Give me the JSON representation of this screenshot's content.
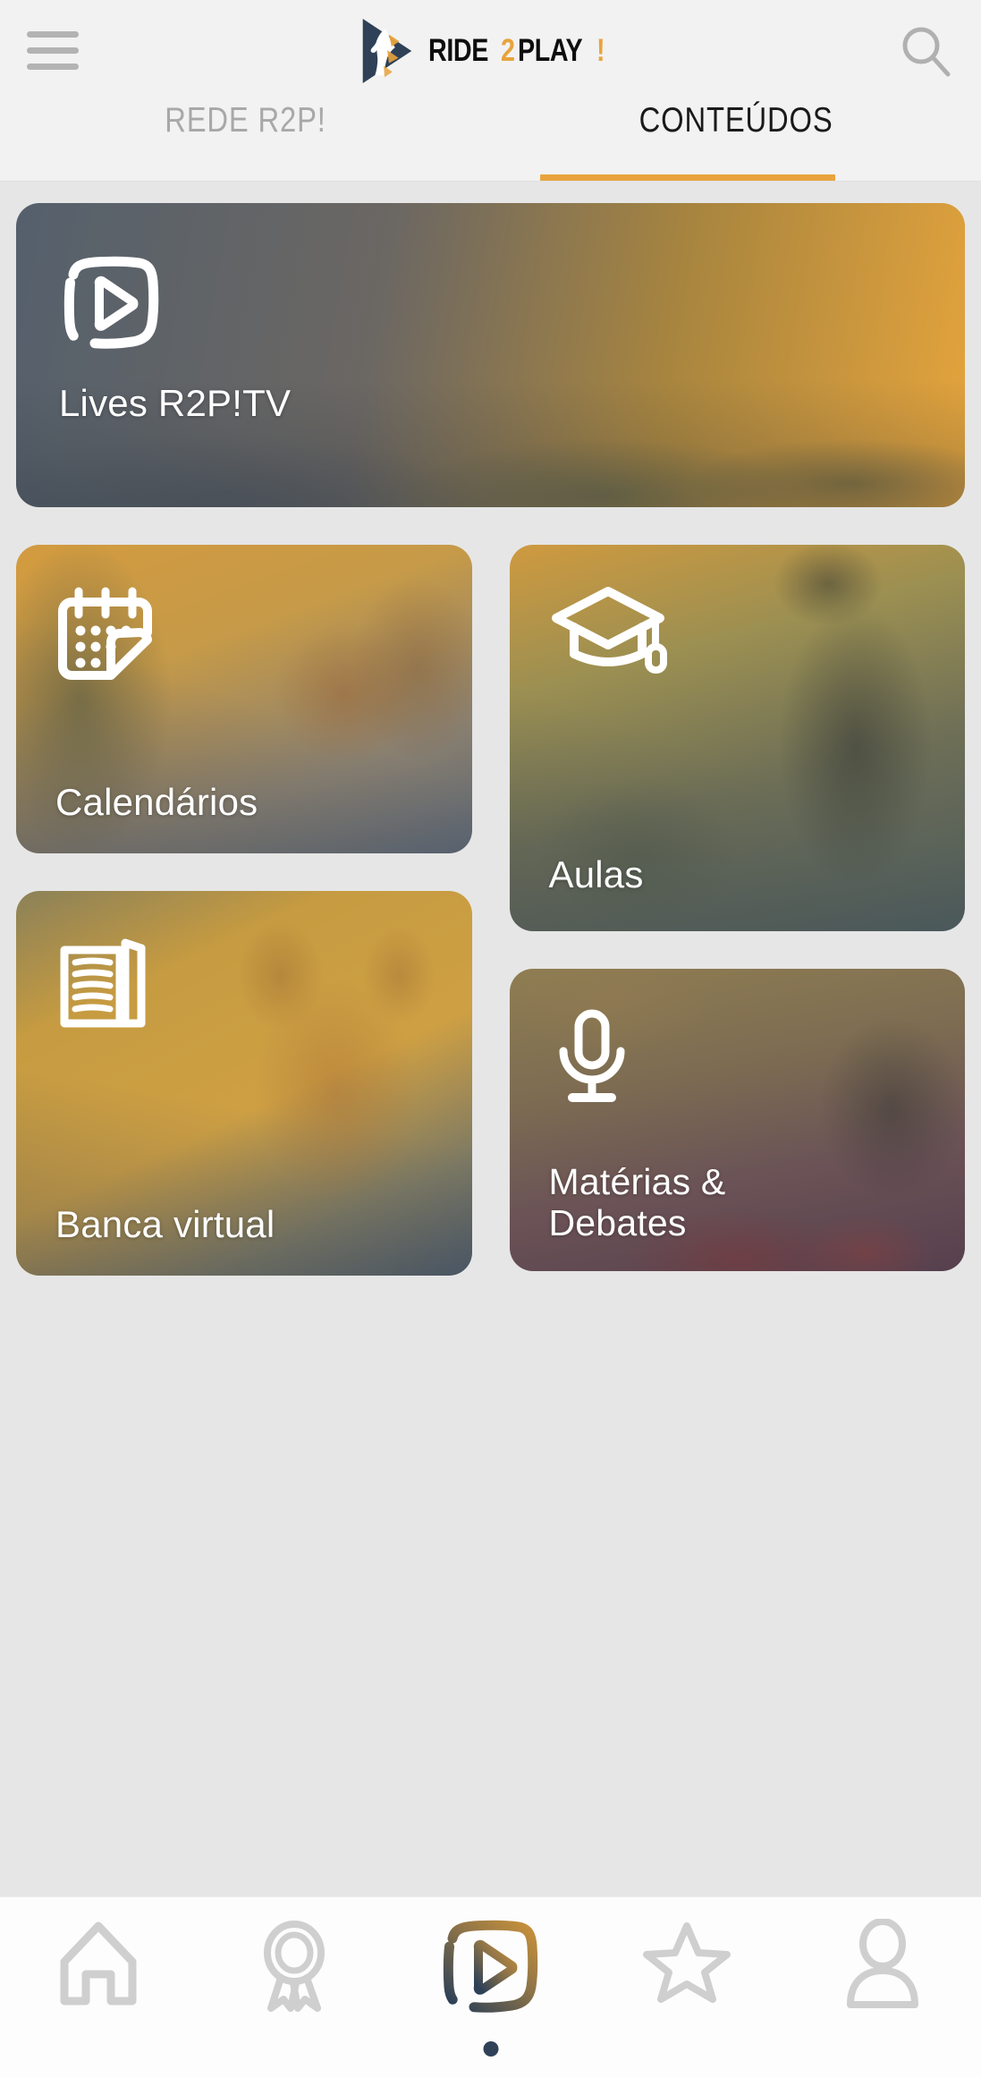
{
  "app": {
    "brand_name_black_1": "RIDE",
    "brand_name_orange_2": "2",
    "brand_name_black_2": "PLAY",
    "brand_name_orange_excl": "!",
    "accent_color": "#e8a33d",
    "navy_color": "#2e4157",
    "background_color": "#e6e6e6",
    "header_background": "#f2f2f2"
  },
  "header": {
    "menu_icon": "hamburger-menu-icon",
    "logo_icon": "ride2play-horse-play-logo-icon",
    "search_icon": "search-icon"
  },
  "tabs": [
    {
      "label": "REDE R2P!",
      "active": false,
      "name": "tab-rede-r2p"
    },
    {
      "label": "CONTEÚDOS",
      "active": true,
      "name": "tab-conteudos"
    }
  ],
  "cards": {
    "hero": {
      "title": "Lives R2P!TV",
      "icon": "play-video-outline-icon",
      "gradient": "linear-gradient(100deg, #55606c 0%, #6b6763 38%, #a8853f 68%, #e5a43c 100%)"
    },
    "calendarios": {
      "title": "Calendários",
      "icon": "calendar-note-icon",
      "gradient": "linear-gradient(160deg, #d39b3f 0%, #c69a48 35%, #8a8070 72%, #5a6472 100%)"
    },
    "aulas": {
      "title": "Aulas",
      "icon": "graduation-cap-icon",
      "gradient": "linear-gradient(165deg, #cf9a3f 0%, #9b8f52 30%, #6e6f56 60%, #4c5a5c 100%)"
    },
    "banca_virtual": {
      "title": "Banca virtual",
      "icon": "newspaper-icon",
      "gradient": "linear-gradient(155deg, #8b8158 0%, #c69b41 25%, #cfa043 55%, #7e7a63 80%, #4e5a68 100%)"
    },
    "materias_debates": {
      "title": "Matérias &\nDebates",
      "title_line1": "Matérias &",
      "title_line2": "Debates",
      "icon": "microphone-icon",
      "gradient": "linear-gradient(170deg, #8f7d52 0%, #7d6c52 35%, #6b5356 65%, #57404e 100%)"
    }
  },
  "bottom_nav": {
    "items": [
      {
        "name": "nav-home",
        "icon": "home-icon",
        "active": false
      },
      {
        "name": "nav-awards",
        "icon": "award-ribbon-icon",
        "active": false
      },
      {
        "name": "nav-videos",
        "icon": "play-video-icon",
        "active": true
      },
      {
        "name": "nav-favorites",
        "icon": "star-icon",
        "active": false
      },
      {
        "name": "nav-profile",
        "icon": "person-icon",
        "active": false
      }
    ],
    "inactive_color": "#cfcfcf",
    "active_gradient_start": "#c8913a",
    "active_gradient_end": "#2e4157",
    "home_indicator": "home-indicator-dot"
  }
}
